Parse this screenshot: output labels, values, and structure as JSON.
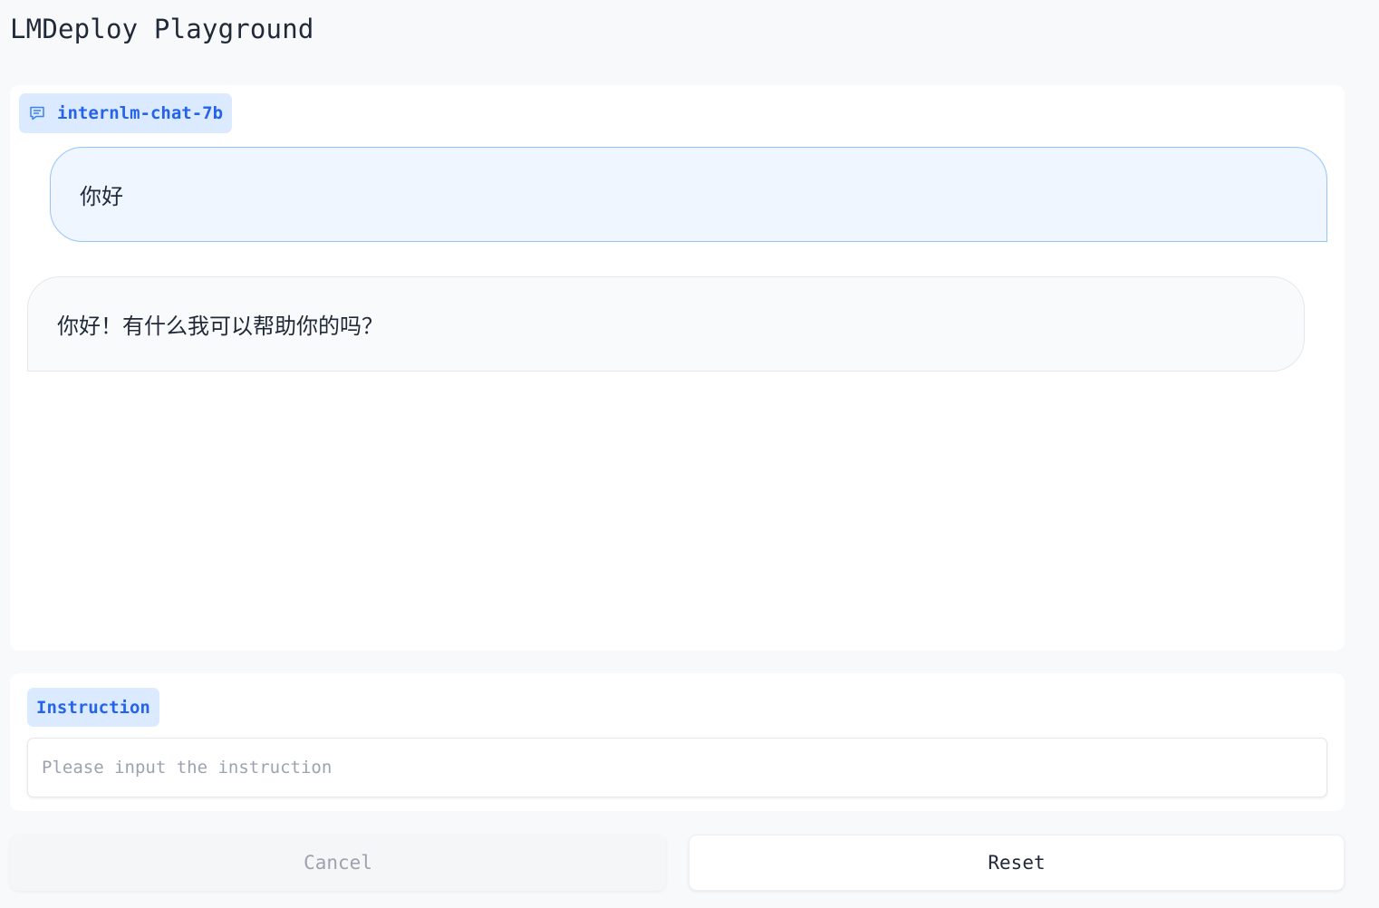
{
  "app": {
    "title": "LMDeploy Playground"
  },
  "chat": {
    "model_label": "internlm-chat-7b",
    "model_icon": "chat-icon",
    "messages": [
      {
        "role": "user",
        "text": "你好"
      },
      {
        "role": "assistant",
        "text": "你好！有什么我可以帮助你的吗？"
      }
    ]
  },
  "instruction": {
    "label": "Instruction",
    "value": "",
    "placeholder": "Please input the instruction"
  },
  "buttons": {
    "cancel_label": "Cancel",
    "reset_label": "Reset"
  },
  "colors": {
    "accent": "#2563eb",
    "badge_bg": "#dbeafe",
    "user_bubble_bg": "#eff6ff",
    "user_bubble_border": "#93c5fd",
    "bot_bubble_bg": "#f9fafb"
  }
}
